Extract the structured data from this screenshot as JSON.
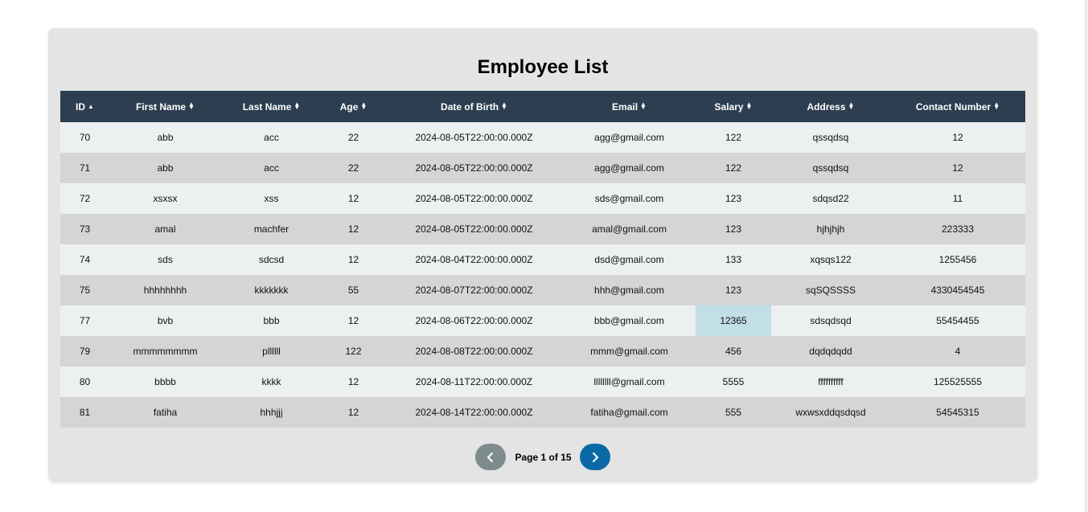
{
  "title": "Employee List",
  "table": {
    "columns": [
      {
        "key": "id",
        "label": "ID",
        "sort": "asc"
      },
      {
        "key": "first_name",
        "label": "First Name",
        "sort": "none"
      },
      {
        "key": "last_name",
        "label": "Last Name",
        "sort": "none"
      },
      {
        "key": "age",
        "label": "Age",
        "sort": "none"
      },
      {
        "key": "dob",
        "label": "Date of Birth",
        "sort": "none"
      },
      {
        "key": "email",
        "label": "Email",
        "sort": "none"
      },
      {
        "key": "salary",
        "label": "Salary",
        "sort": "none"
      },
      {
        "key": "address",
        "label": "Address",
        "sort": "none"
      },
      {
        "key": "contact",
        "label": "Contact Number",
        "sort": "none"
      }
    ],
    "rows": [
      [
        "70",
        "abb",
        "acc",
        "22",
        "2024-08-05T22:00:00.000Z",
        "agg@gmail.com",
        "122",
        "qssqdsq",
        "12"
      ],
      [
        "71",
        "abb",
        "acc",
        "22",
        "2024-08-05T22:00:00.000Z",
        "agg@gmail.com",
        "122",
        "qssqdsq",
        "12"
      ],
      [
        "72",
        "xsxsx",
        "xss",
        "12",
        "2024-08-05T22:00:00.000Z",
        "sds@gmail.com",
        "123",
        "sdqsd22",
        "11"
      ],
      [
        "73",
        "amal",
        "machfer",
        "12",
        "2024-08-05T22:00:00.000Z",
        "amal@gmail.com",
        "123",
        "hjhjhjh",
        "223333"
      ],
      [
        "74",
        "sds",
        "sdcsd",
        "12",
        "2024-08-04T22:00:00.000Z",
        "dsd@gmail.com",
        "133",
        "xqsqs122",
        "1255456"
      ],
      [
        "75",
        "hhhhhhhh",
        "kkkkkkk",
        "55",
        "2024-08-07T22:00:00.000Z",
        "hhh@gmail.com",
        "123",
        "sqSQSSSS",
        "4330454545"
      ],
      [
        "77",
        "bvb",
        "bbb",
        "12",
        "2024-08-06T22:00:00.000Z",
        "bbb@gmail.com",
        "12365",
        "sdsqdsqd",
        "55454455"
      ],
      [
        "79",
        "mmmmmmmm",
        "pllllll",
        "122",
        "2024-08-08T22:00:00.000Z",
        "mmm@gmail.com",
        "456",
        "dqdqdqdd",
        "4"
      ],
      [
        "80",
        "bbbb",
        "kkkk",
        "12",
        "2024-08-11T22:00:00.000Z",
        "llllllll@gmail.com",
        "5555",
        "ffffffffff",
        "125525555"
      ],
      [
        "81",
        "fatiha",
        "hhhjjj",
        "12",
        "2024-08-14T22:00:00.000Z",
        "fatiha@gmail.com",
        "555",
        "wxwsxddqsdqsd",
        "54545315"
      ]
    ],
    "highlighted_cell": {
      "row": 6,
      "col": 6
    }
  },
  "pagination": {
    "page_label": "Page",
    "current_page": "1",
    "of_label": "of",
    "total_pages": "15",
    "prev_icon": "chevron-left-icon",
    "next_icon": "chevron-right-icon"
  },
  "colors": {
    "header_bg": "#2c3e50",
    "row_odd": "#ecf0f1",
    "row_even": "#d5d5d5",
    "highlight": "#c2dee6",
    "prev_button": "#7f8c8d",
    "next_button": "#0b6aa6"
  }
}
